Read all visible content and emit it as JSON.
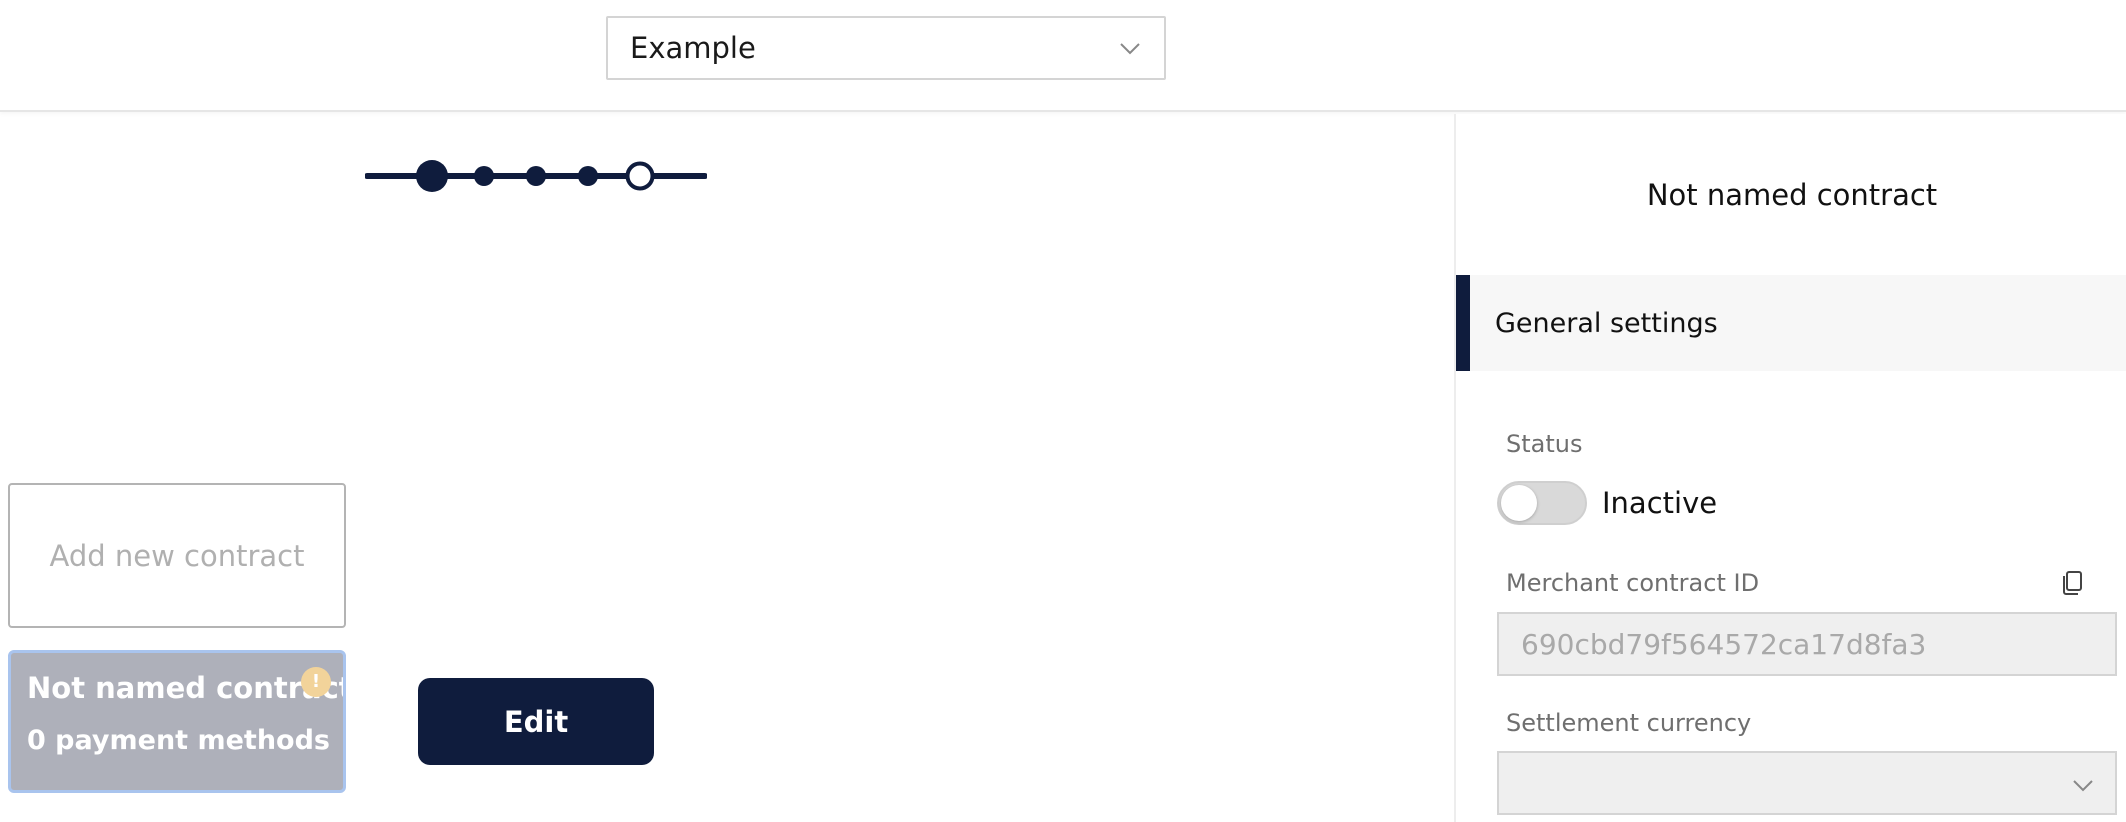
{
  "topbar": {
    "project_select": {
      "value": "Example",
      "icon": "chevron-down-icon"
    }
  },
  "stepper": {
    "steps": 5,
    "current_step": 1
  },
  "contracts": {
    "add_label": "Add new contract",
    "items": [
      {
        "name": "Not named contract",
        "payment_methods": "0 payment methods",
        "warning_icon": "warning-icon",
        "warning_glyph": "!",
        "warning_color": "#f2d39a"
      }
    ]
  },
  "actions": {
    "edit_label": "Edit"
  },
  "panel": {
    "title": "Not named contract",
    "section": "General settings",
    "status": {
      "label": "Status",
      "toggle_state": "Inactive"
    },
    "merchant_contract_id": {
      "label": "Merchant contract ID",
      "value": "690cbd79f564572ca17d8fa3",
      "copy_icon": "copy-icon"
    },
    "settlement_currency": {
      "label": "Settlement currency",
      "value": ""
    }
  },
  "colors": {
    "primary": "#0f1c3d",
    "card_bg": "#aeb0ba",
    "card_border": "#a9c4ee",
    "input_bg": "#efefef"
  }
}
